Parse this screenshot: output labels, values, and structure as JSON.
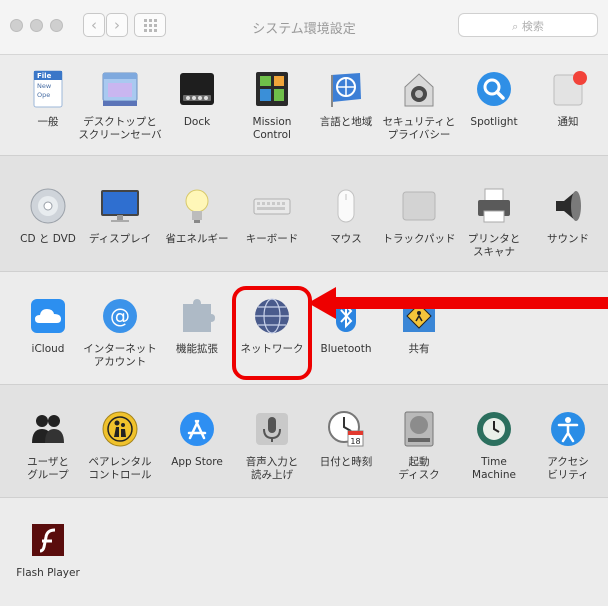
{
  "window": {
    "title": "システム環境設定"
  },
  "search": {
    "placeholder": "検索"
  },
  "toolbar": {
    "back": "‹",
    "forward": "›"
  },
  "sections": [
    {
      "items": [
        {
          "icon": "general-icon",
          "label": "一般"
        },
        {
          "icon": "desktop-screensaver-icon",
          "label": "デスクトップと\nスクリーンセーバ"
        },
        {
          "icon": "dock-icon",
          "label": "Dock"
        },
        {
          "icon": "mission-control-icon",
          "label": "Mission\nControl"
        },
        {
          "icon": "language-region-icon",
          "label": "言語と地域"
        },
        {
          "icon": "security-privacy-icon",
          "label": "セキュリティと\nプライバシー"
        },
        {
          "icon": "spotlight-icon",
          "label": "Spotlight"
        },
        {
          "icon": "notifications-icon",
          "label": "通知"
        }
      ]
    },
    {
      "items": [
        {
          "icon": "cd-dvd-icon",
          "label": "CD と DVD"
        },
        {
          "icon": "displays-icon",
          "label": "ディスプレイ"
        },
        {
          "icon": "energy-saver-icon",
          "label": "省エネルギー"
        },
        {
          "icon": "keyboard-icon",
          "label": "キーボード"
        },
        {
          "icon": "mouse-icon",
          "label": "マウス"
        },
        {
          "icon": "trackpad-icon",
          "label": "トラックパッド"
        },
        {
          "icon": "printer-scanner-icon",
          "label": "プリンタと\nスキャナ"
        },
        {
          "icon": "sound-icon",
          "label": "サウンド"
        }
      ]
    },
    {
      "items": [
        {
          "icon": "icloud-icon",
          "label": "iCloud"
        },
        {
          "icon": "internet-accounts-icon",
          "label": "インターネット\nアカウント"
        },
        {
          "icon": "extensions-icon",
          "label": "機能拡張"
        },
        {
          "icon": "network-icon",
          "label": "ネットワーク"
        },
        {
          "icon": "bluetooth-icon",
          "label": "Bluetooth"
        },
        {
          "icon": "sharing-icon",
          "label": "共有"
        }
      ]
    },
    {
      "items": [
        {
          "icon": "users-groups-icon",
          "label": "ユーザと\nグループ"
        },
        {
          "icon": "parental-controls-icon",
          "label": "ペアレンタル\nコントロール"
        },
        {
          "icon": "app-store-icon",
          "label": "App Store"
        },
        {
          "icon": "dictation-speech-icon",
          "label": "音声入力と\n読み上げ"
        },
        {
          "icon": "date-time-icon",
          "label": "日付と時刻"
        },
        {
          "icon": "startup-disk-icon",
          "label": "起動\nディスク"
        },
        {
          "icon": "time-machine-icon",
          "label": "Time\nMachine"
        },
        {
          "icon": "accessibility-icon",
          "label": "アクセシ\nビリティ"
        }
      ]
    },
    {
      "items": [
        {
          "icon": "flash-player-icon",
          "label": "Flash Player"
        }
      ]
    }
  ],
  "general_icon_text": [
    "File",
    "New",
    "Ope"
  ],
  "calendar_icon_day": "18",
  "annotation": {
    "color": "#ee0000",
    "target": "network"
  }
}
